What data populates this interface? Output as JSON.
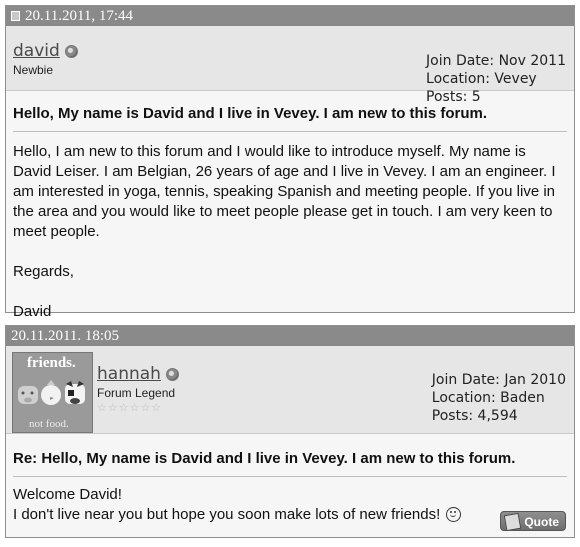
{
  "posts": [
    {
      "timestamp": "20.11.2011, 17:44",
      "username": "david",
      "usertitle": "Newbie",
      "join_date": "Join Date: Nov 2011",
      "location": "Location: Vevey",
      "posts_count": "Posts: 5",
      "title": "Hello, My name is David and I live in Vevey. I am new to this forum.",
      "paragraphs": [
        "Hello, I am new to this forum and I would like to introduce myself. My name is David Leiser. I am Belgian, 26 years of age and I live in Vevey. I am an engineer. I am interested in yoga, tennis, speaking Spanish and meeting people. If you live in the area and you would like to meet people please get in touch. I am very keen to meet people.",
        "Regards,",
        "David"
      ]
    },
    {
      "timestamp": "20.11.2011. 18:05",
      "username": "hannah",
      "usertitle": "Forum Legend",
      "avatar_text": "friends.",
      "avatar_footer": "not food.",
      "join_date": "Join Date: Jan 2010",
      "location": "Location: Baden",
      "posts_count": "Posts: 4,594",
      "title": "Re: Hello, My name is David and I live in Vevey. I am new to this forum.",
      "body_lines": [
        "Welcome David!",
        "I don't live near you but hope you soon make lots of new friends!"
      ],
      "quote_label": "Quote",
      "rating_stars": "☆☆☆☆☆☆"
    }
  ]
}
